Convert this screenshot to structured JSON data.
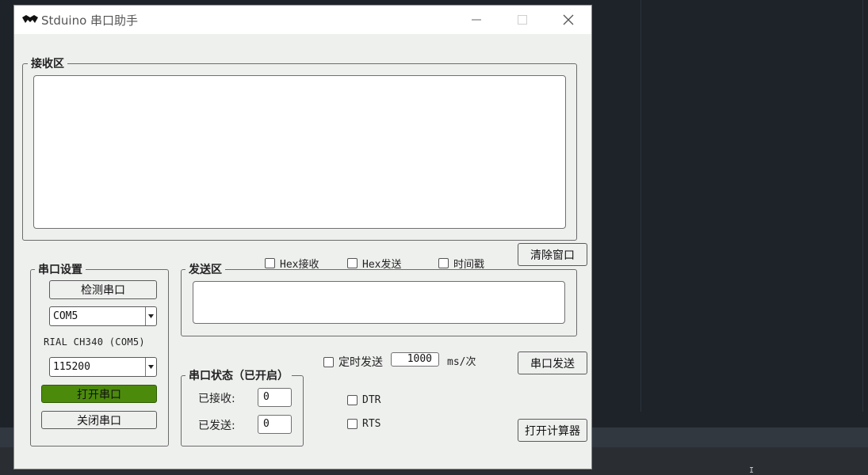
{
  "window": {
    "title": "Stduino 串口助手",
    "min_icon": "minimize-icon",
    "max_icon": "maximize-icon",
    "close_icon": "close-icon"
  },
  "receive": {
    "legend": "接收区",
    "content": ""
  },
  "checkboxes": {
    "hex_receive": "Hex接收",
    "hex_send": "Hex发送",
    "timestamp": "时间戳",
    "timed_send": "定时发送",
    "dtr": "DTR",
    "rts": "RTS"
  },
  "buttons": {
    "clear_window": "清除窗口",
    "detect_port": "检测串口",
    "open_port": "打开串口",
    "close_port": "关闭串口",
    "serial_send": "串口发送",
    "open_calculator": "打开计算器"
  },
  "port_settings": {
    "legend": "串口设置",
    "port_value": "COM5",
    "device_label": "RIAL CH340 (COM5)",
    "baud_value": "115200"
  },
  "send": {
    "legend": "发送区",
    "content": ""
  },
  "timer": {
    "interval": "1000",
    "unit": "ms/次"
  },
  "status": {
    "legend": "串口状态（已开启）",
    "received_label": "已接收:",
    "received_value": "0",
    "sent_label": "已发送:",
    "sent_value": "0"
  },
  "colors": {
    "accent_green": "#4c8a0c",
    "window_bg": "#eef0ee"
  }
}
